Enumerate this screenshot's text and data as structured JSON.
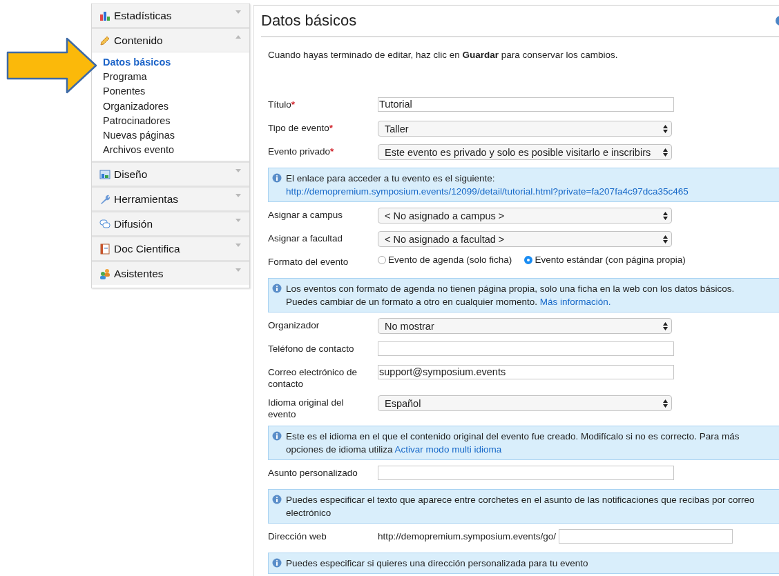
{
  "sidebar": {
    "sections": [
      {
        "label": "Estadísticas",
        "expanded": false
      },
      {
        "label": "Contenido",
        "expanded": true,
        "items": [
          {
            "label": "Datos básicos",
            "selected": true
          },
          {
            "label": "Programa",
            "selected": false
          },
          {
            "label": "Ponentes",
            "selected": false
          },
          {
            "label": "Organizadores",
            "selected": false
          },
          {
            "label": "Patrocinadores",
            "selected": false
          },
          {
            "label": "Nuevas páginas",
            "selected": false
          },
          {
            "label": "Archivos evento",
            "selected": false
          }
        ]
      },
      {
        "label": "Diseño",
        "expanded": false
      },
      {
        "label": "Herramientas",
        "expanded": false
      },
      {
        "label": "Difusión",
        "expanded": false
      },
      {
        "label": "Doc Cientifica",
        "expanded": false
      },
      {
        "label": "Asistentes",
        "expanded": false
      }
    ]
  },
  "main": {
    "title": "Datos básicos",
    "intro": "Cuando hayas terminado de editar, haz clic en **Guardar** para conservar los cambios.",
    "rows": [
      {
        "kind": "text",
        "label": "Título",
        "mark": "*",
        "value": "Tutorial"
      },
      {
        "kind": "select",
        "label": "Tipo de evento",
        "mark": "*",
        "value": "Taller"
      },
      {
        "kind": "select",
        "label": "Evento privado",
        "mark": "*",
        "value": "Este evento es privado y solo es posible visitarlo e inscribirs"
      },
      {
        "kind": "info",
        "text": "El enlace para acceder a tu evento es el siguiente:",
        "link": "http://demopremium.symposium.events/12099/detail/tutorial.html?private=fa207fa4c97dca35c465"
      },
      {
        "kind": "select",
        "label": "Asignar a campus",
        "value": "< No asignado a campus >"
      },
      {
        "kind": "select",
        "label": "Asignar a facultad",
        "value": "< No asignado a facultad >"
      },
      {
        "kind": "radio",
        "label": "Formato del evento",
        "options": [
          {
            "label": "Evento de agenda (solo ficha)",
            "selected": false
          },
          {
            "label": "Evento estándar (con página propia)",
            "selected": true
          }
        ]
      },
      {
        "kind": "info",
        "text": "Los eventos con formato de agenda no tienen página propia, solo una ficha en la web con los datos básicos. Puedes cambiar de un formato a otro en cualquier momento.",
        "link": "Más información."
      },
      {
        "kind": "select",
        "label": "Organizador",
        "value": "No mostrar"
      },
      {
        "kind": "text",
        "label": "Teléfono de contacto",
        "value": ""
      },
      {
        "kind": "text",
        "label": "Correo electrónico de contacto",
        "value": "support@symposium.events"
      },
      {
        "kind": "select",
        "label": "Idioma original del evento",
        "value": "Español"
      },
      {
        "kind": "info",
        "text": "Este es el idioma en el que el contenido original del evento fue creado. Modifícalo si no es correcto. Para más opciones de idioma utiliza",
        "link": "Activar modo multi idioma"
      },
      {
        "kind": "text",
        "label": "Asunto personalizado",
        "value": ""
      },
      {
        "kind": "info",
        "text": "Puedes especificar el texto que aparece entre corchetes en el asunto de las notificaciones que recibas por correo electrónico"
      },
      {
        "kind": "url",
        "label": "Dirección web",
        "prefix": "http://demopremium.symposium.events/go/",
        "value": ""
      },
      {
        "kind": "info",
        "text": "Puedes especificar si quieres una dirección personalizada para tu evento"
      }
    ]
  }
}
